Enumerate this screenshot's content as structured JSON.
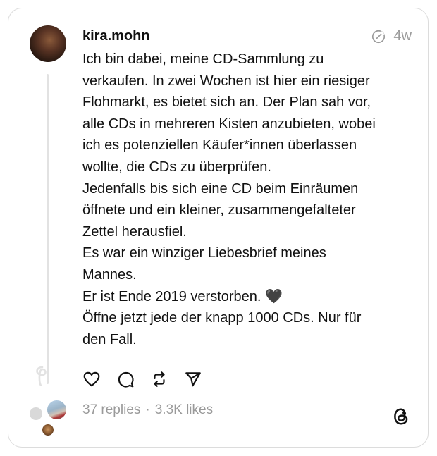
{
  "post": {
    "username": "kira.mohn",
    "time_ago": "4w",
    "lines": [
      "Ich bin dabei, meine CD-Sammlung zu",
      "verkaufen. In zwei Wochen ist hier ein riesiger",
      "Flohmarkt, es bietet sich an. Der Plan sah vor,",
      "alle CDs in mehreren Kisten anzubieten, wobei",
      "ich es potenziellen Käufer*innen überlassen",
      "wollte, die CDs zu überprüfen.",
      "Jedenfalls bis sich eine CD beim Einräumen",
      "öffnete und ein kleiner, zusammengefalteter",
      "Zettel herausfiel.",
      "Es war ein winziger Liebesbrief meines",
      "Mannes.",
      "Er ist Ende 2019 verstorben. 🖤",
      "Öffne jetzt jede der knapp 1000 CDs. Nur für",
      "den Fall."
    ]
  },
  "stats": {
    "replies": "37 replies",
    "separator": "·",
    "likes": "3.3K likes"
  },
  "icons": {
    "meta": "edit-circle-icon",
    "like": "heart-icon",
    "reply": "comment-icon",
    "repost": "repost-icon",
    "share": "send-icon",
    "brand": "threads-logo-icon"
  },
  "colors": {
    "text": "#111111",
    "muted": "#9a9a9a",
    "border": "#dcdcdc"
  }
}
